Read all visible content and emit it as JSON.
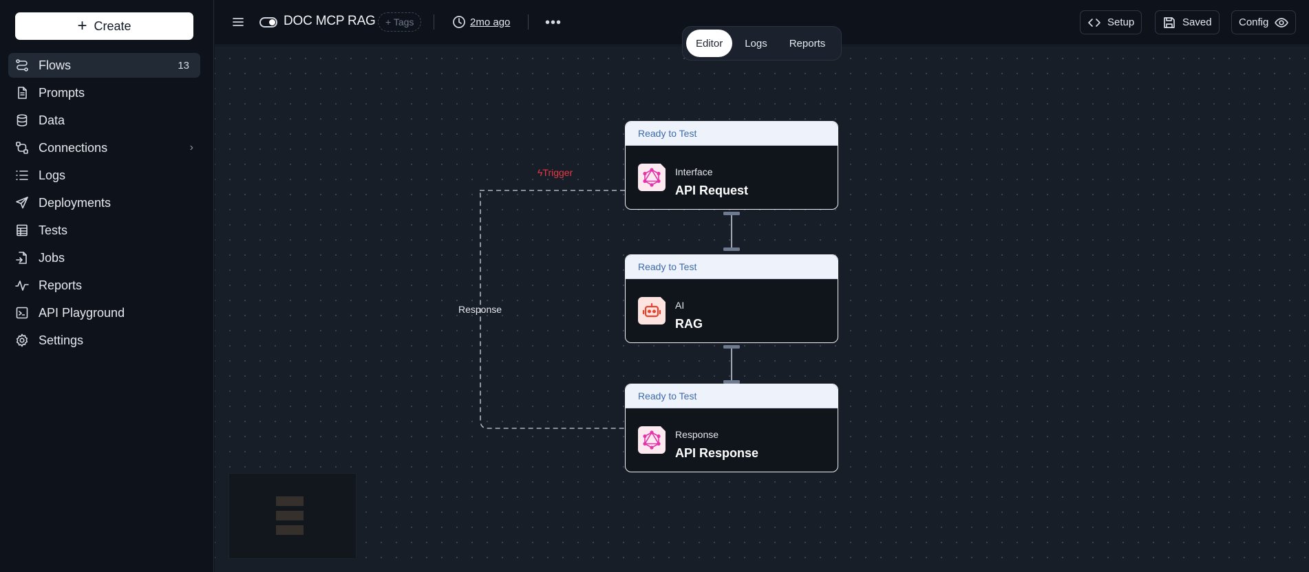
{
  "sidebar": {
    "create_label": "Create",
    "items": [
      {
        "label": "Flows",
        "icon": "flows-icon",
        "count": "13",
        "active": true
      },
      {
        "label": "Prompts",
        "icon": "document-icon"
      },
      {
        "label": "Data",
        "icon": "database-icon"
      },
      {
        "label": "Connections",
        "icon": "connections-icon",
        "has_chevron": true
      },
      {
        "label": "Logs",
        "icon": "list-icon"
      },
      {
        "label": "Deployments",
        "icon": "send-icon"
      },
      {
        "label": "Tests",
        "icon": "table-icon"
      },
      {
        "label": "Jobs",
        "icon": "file-export-icon"
      },
      {
        "label": "Reports",
        "icon": "activity-icon"
      },
      {
        "label": "API Playground",
        "icon": "terminal-icon"
      },
      {
        "label": "Settings",
        "icon": "gear-icon"
      }
    ]
  },
  "header": {
    "flow_title": "DOC MCP RAG",
    "tags_label": "+ Tags",
    "updated": "2mo ago",
    "tabs": [
      {
        "label": "Editor",
        "active": true
      },
      {
        "label": "Logs"
      },
      {
        "label": "Reports"
      }
    ],
    "setup_label": "Setup",
    "saved_label": "Saved",
    "config_label": "Config"
  },
  "canvas": {
    "edge_labels": {
      "trigger": "Trigger",
      "response": "Response"
    },
    "nodes": [
      {
        "status": "Ready to Test",
        "kind": "Interface",
        "name": "API Request",
        "icon": "graphql-icon"
      },
      {
        "status": "Ready to Test",
        "kind": "AI",
        "name": "RAG",
        "icon": "robot-icon"
      },
      {
        "status": "Ready to Test",
        "kind": "Response",
        "name": "API Response",
        "icon": "graphql-icon"
      }
    ]
  },
  "colors": {
    "trigger": "#e63946",
    "status_text": "#3d6aa8",
    "graphql_icon": "#e535ab",
    "robot_icon": "#e8412c"
  }
}
